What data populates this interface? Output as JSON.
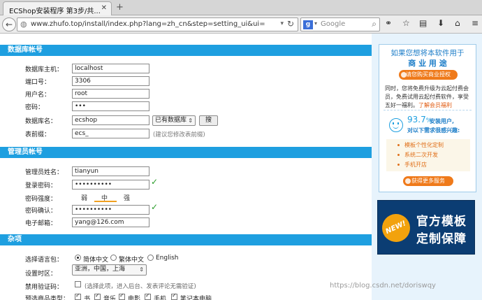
{
  "browser": {
    "tab_title": "ECShop安装程序 第3步/共...",
    "tab_close": "✕",
    "new_tab": "+",
    "url": "www.zhufo.top/install/index.php?lang=zh_cn&step=setting_ui&ui=",
    "search_placeholder": "Google",
    "search_engine_letter": "g"
  },
  "db_section": {
    "title": "数据库帐号",
    "host_label": "数据库主机：",
    "host_value": "localhost",
    "port_label": "端口号：",
    "port_value": "3306",
    "user_label": "用户名：",
    "user_value": "root",
    "password_label": "密码：",
    "password_value": "•••",
    "dbname_label": "数据库名：",
    "dbname_value": "ecshop",
    "db_select": "已有数据库",
    "search_button": "搜",
    "prefix_label": "表前缀：",
    "prefix_value": "ecs_",
    "prefix_hint": "(建议您修改表前缀)"
  },
  "admin_section": {
    "title": "管理员帐号",
    "name_label": "管理员姓名：",
    "name_value": "tianyun",
    "password_label": "登录密码：",
    "password_value": "••••••••••",
    "strength_label": "密码强度：",
    "strength_weak": "弱",
    "strength_mid": "中",
    "strength_strong": "强",
    "confirm_label": "密码确认：",
    "confirm_value": "••••••••••",
    "email_label": "电子邮箱：",
    "email_value": "yang@126.com",
    "check_mark": "✓"
  },
  "misc_section": {
    "title": "杂项",
    "lang_label": "选择语言包：",
    "lang_options": [
      "简体中文",
      "繁体中文",
      "English"
    ],
    "lang_selected": "简体中文",
    "timezone_label": "设置时区：",
    "timezone_value": "亚洲，中国，上海",
    "captcha_label": "禁用验证码：",
    "captcha_hint": "(选择此项，进入后台、发表评论无需验证)",
    "goods_label": "预选商品类型：",
    "goods_options": [
      "书",
      "音乐",
      "电影",
      "手机",
      "笔记本电脑"
    ]
  },
  "promo": {
    "line1": "如果您想将本软件用于",
    "line2": "商 业 用 途",
    "buy_button": "请您购买商业授权",
    "text": "同时，您将免费升级为云起付费会员，免费试用云起付费软件，享受五好一福利。",
    "link": "了解会员福利",
    "users_number": "93.7",
    "users_unit": "%",
    "users_suffix": "安装用户,",
    "users_sub": "对以下需求很感兴趣:",
    "features": [
      "模板个性化定制",
      "系统二次开发",
      "手机开店"
    ],
    "more_button": "获得更多服务"
  },
  "banner": {
    "badge": "NEW!",
    "line1": "官方模板",
    "line2": "定制保障"
  },
  "watermark": "https://blog.csdn.net/doriswqy"
}
